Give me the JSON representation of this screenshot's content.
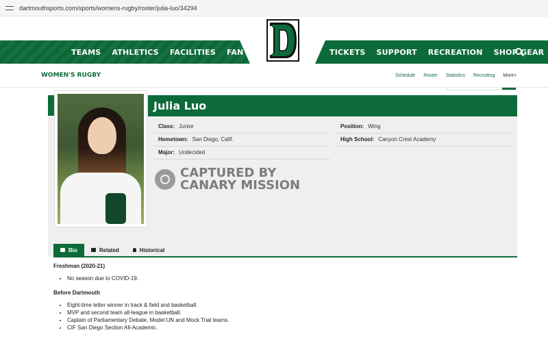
{
  "browser": {
    "url": "dartmouthsports.com/sports/womens-rugby/roster/julia-luo/34294"
  },
  "nav": {
    "left": [
      "TEAMS",
      "ATHLETICS",
      "FACILITIES",
      "FAN ZONE"
    ],
    "right": [
      "TICKETS",
      "SUPPORT",
      "RECREATION",
      "SHOP GEAR"
    ]
  },
  "logo": {
    "letter": "D"
  },
  "subnav": {
    "sport": "WOMEN'S RUGBY",
    "links": [
      "Schedule",
      "Roster",
      "Statistics",
      "Recruiting",
      "More+"
    ]
  },
  "profile": {
    "name": "Julia Luo",
    "fields": {
      "class": {
        "label": "Class:",
        "value": "Junior"
      },
      "position": {
        "label": "Position:",
        "value": "Wing"
      },
      "hometown": {
        "label": "Hometown:",
        "value": "San Diego, Calif."
      },
      "high_school": {
        "label": "High School:",
        "value": "Canyon Crest Academy"
      },
      "major": {
        "label": "Major:",
        "value": "Undecided"
      }
    },
    "watermark": {
      "line1": "CAPTURED BY",
      "line2": "CANARY MISSION"
    }
  },
  "tabs": [
    "Bio",
    "Related",
    "Historical"
  ],
  "bio": {
    "sections": [
      {
        "heading": "Freshman (2020-21)",
        "items": [
          "No season due to COVID-19."
        ]
      },
      {
        "heading": "Before Dartmouth",
        "items": [
          "Eight-time letter winner in track & field and basketball.",
          "MVP and second team all-league in basketball.",
          "Captain of Parliamentary Debate, Model UN and Mock Trial teams.",
          "CIF San Diego Section All-Academic."
        ]
      }
    ]
  },
  "colors": {
    "primary": "#0d6b3a",
    "panel": "#efefef"
  }
}
